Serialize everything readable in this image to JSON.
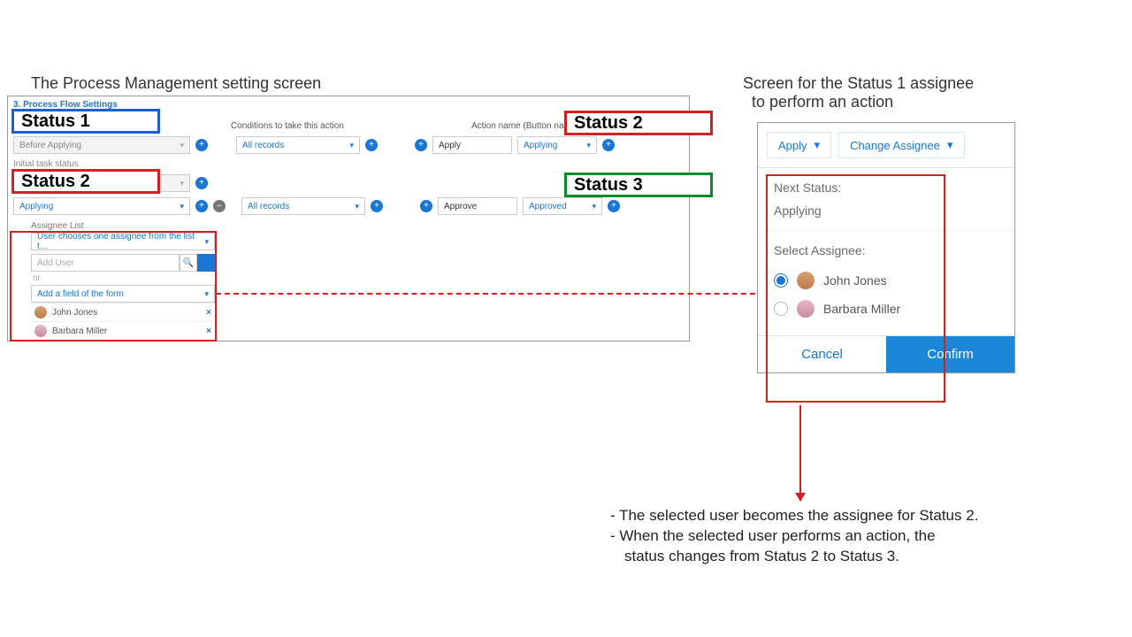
{
  "captions": {
    "left": "The Process Management setting screen",
    "right": "Screen for the Status 1 assignee\n  to perform an action"
  },
  "settings": {
    "title": "3. Process Flow Settings",
    "headers": {
      "conditions": "Conditions to take this action",
      "action_name": "Action name (Button name)"
    },
    "row1": {
      "status_dd": "Before Applying",
      "cond_dd": "All records",
      "action_input": "Apply",
      "next_dd": "Applying"
    },
    "initial_label": "Initial task status",
    "row2": {
      "status_dd_visible": "",
      "status_dd2": "Applying",
      "cond_dd": "All records",
      "action_input": "Approve",
      "next_dd": "Approved"
    },
    "assignee": {
      "title": "Assignee List",
      "mode_dd": "User chooses one assignee from the list t…",
      "add_user_placeholder": "Add User",
      "or": "or",
      "field_dd": "Add a field of the form",
      "users": [
        {
          "name": "John Jones",
          "gender": "m"
        },
        {
          "name": "Barbara Miller",
          "gender": "f"
        }
      ]
    }
  },
  "overlay": {
    "s1": "Status 1",
    "s2a": "Status 2",
    "s2b": "Status 2",
    "s3": "Status 3"
  },
  "popup": {
    "apply_btn": "Apply",
    "change_btn": "Change Assignee",
    "next_label": "Next Status:",
    "next_value": "Applying",
    "select_label": "Select Assignee:",
    "options": [
      {
        "name": "John Jones",
        "selected": true,
        "gender": "m"
      },
      {
        "name": "Barbara Miller",
        "selected": false,
        "gender": "f"
      }
    ],
    "cancel": "Cancel",
    "confirm": "Confirm"
  },
  "notes": {
    "l1": "- The selected user becomes the assignee for Status 2.",
    "l2": "- When the selected user performs an action, the",
    "l3": "status changes from Status 2 to Status 3."
  }
}
